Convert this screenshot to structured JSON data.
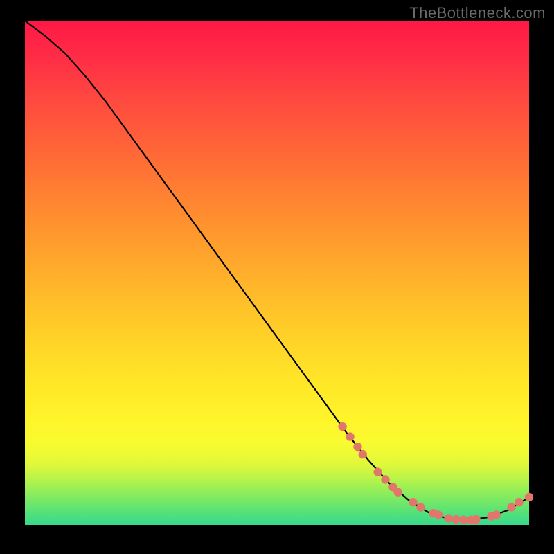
{
  "watermark": "TheBottleneck.com",
  "colors": {
    "curve": "#000000",
    "marker_fill": "#e2766b",
    "marker_stroke": "#c9584d",
    "background_black": "#000000"
  },
  "chart_data": {
    "type": "line",
    "title": "",
    "xlabel": "",
    "ylabel": "",
    "xlim": [
      0,
      100
    ],
    "ylim": [
      0,
      100
    ],
    "grid": false,
    "curve": {
      "x": [
        0,
        4,
        8,
        12,
        16,
        20,
        24,
        28,
        32,
        36,
        40,
        44,
        48,
        52,
        56,
        60,
        64,
        68,
        72,
        76,
        80,
        84,
        88,
        92,
        96,
        100
      ],
      "y": [
        100,
        97,
        93.5,
        89,
        84,
        78.5,
        73,
        67.5,
        62,
        56.5,
        51,
        45.5,
        40,
        34.5,
        29,
        23.5,
        18,
        13,
        8.5,
        5,
        2.5,
        1.2,
        1,
        1.5,
        3,
        5.5
      ]
    },
    "markers": [
      {
        "x": 63,
        "y": 19.5
      },
      {
        "x": 64.5,
        "y": 17.5
      },
      {
        "x": 66,
        "y": 15.5
      },
      {
        "x": 67,
        "y": 14
      },
      {
        "x": 70,
        "y": 10.5
      },
      {
        "x": 71.5,
        "y": 9
      },
      {
        "x": 73,
        "y": 7.5
      },
      {
        "x": 74,
        "y": 6.5
      },
      {
        "x": 77,
        "y": 4.5
      },
      {
        "x": 78.5,
        "y": 3.5
      },
      {
        "x": 81,
        "y": 2.3
      },
      {
        "x": 82,
        "y": 2
      },
      {
        "x": 84,
        "y": 1.3
      },
      {
        "x": 85.5,
        "y": 1.1
      },
      {
        "x": 87,
        "y": 1
      },
      {
        "x": 88.5,
        "y": 1
      },
      {
        "x": 89.5,
        "y": 1.1
      },
      {
        "x": 92.5,
        "y": 1.7
      },
      {
        "x": 93.5,
        "y": 2
      },
      {
        "x": 96.5,
        "y": 3.5
      },
      {
        "x": 98,
        "y": 4.5
      },
      {
        "x": 100,
        "y": 5.5
      }
    ]
  }
}
